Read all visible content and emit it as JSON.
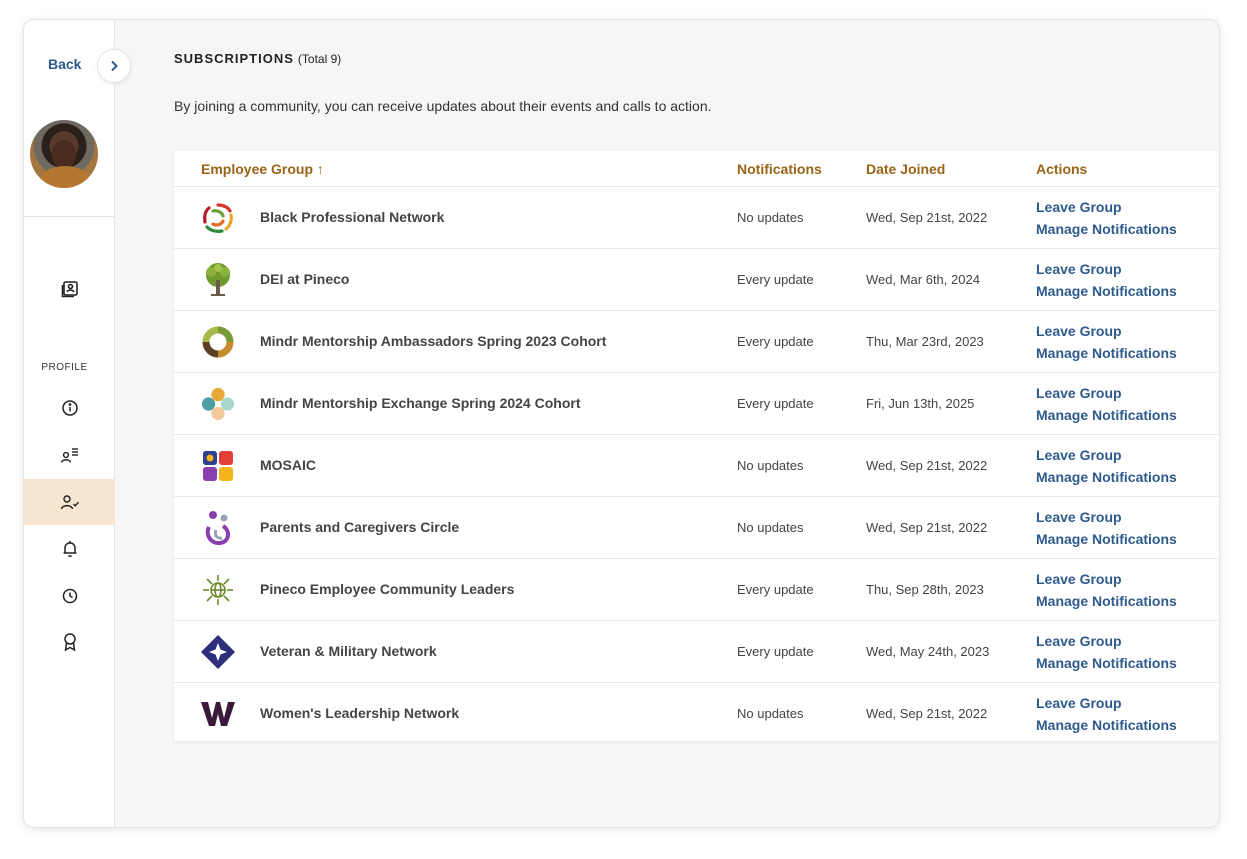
{
  "nav": {
    "back_label": "Back",
    "profile_section_label": "PROFILE",
    "icons": [
      "expand-chevron-icon",
      "newspaper-icon",
      "info-icon",
      "user-list-icon",
      "user-check-icon",
      "bell-icon",
      "clock-icon",
      "award-icon"
    ]
  },
  "page": {
    "title": "SUBSCRIPTIONS",
    "total": "(Total 9)",
    "description": "By joining a community, you can receive updates about their events and calls to action."
  },
  "table": {
    "headers": {
      "group": "Employee Group ↑",
      "notifications": "Notifications",
      "date_joined": "Date Joined",
      "actions": "Actions"
    },
    "rows": [
      {
        "name": "Black Professional Network",
        "notifications": "No updates",
        "date": "Wed, Sep 21st, 2022",
        "leave": "Leave Group",
        "manage": "Manage Notifications",
        "logo": "multicolor-ring-logo"
      },
      {
        "name": "DEI at Pineco",
        "notifications": "Every update",
        "date": "Wed, Mar 6th, 2024",
        "leave": "Leave Group",
        "manage": "Manage Notifications",
        "logo": "tree-logo"
      },
      {
        "name": "Mindr Mentorship Ambassadors Spring 2023 Cohort",
        "notifications": "Every update",
        "date": "Thu, Mar 23rd, 2023",
        "leave": "Leave Group",
        "manage": "Manage Notifications",
        "logo": "segmented-circle-logo"
      },
      {
        "name": "Mindr Mentorship Exchange Spring 2024 Cohort",
        "notifications": "Every update",
        "date": "Fri, Jun 13th, 2025",
        "leave": "Leave Group",
        "manage": "Manage Notifications",
        "logo": "dots-cluster-logo"
      },
      {
        "name": "MOSAIC",
        "notifications": "No updates",
        "date": "Wed, Sep 21st, 2022",
        "leave": "Leave Group",
        "manage": "Manage Notifications",
        "logo": "mosaic-tiles-logo"
      },
      {
        "name": "Parents and Caregivers Circle",
        "notifications": "No updates",
        "date": "Wed, Sep 21st, 2022",
        "leave": "Leave Group",
        "manage": "Manage Notifications",
        "logo": "parent-child-logo"
      },
      {
        "name": "Pineco Employee Community Leaders",
        "notifications": "Every update",
        "date": "Thu, Sep 28th, 2023",
        "leave": "Leave Group",
        "manage": "Manage Notifications",
        "logo": "globe-burst-logo"
      },
      {
        "name": "Veteran & Military Network",
        "notifications": "Every update",
        "date": "Wed, May 24th, 2023",
        "leave": "Leave Group",
        "manage": "Manage Notifications",
        "logo": "diamond-star-logo"
      },
      {
        "name": "Women's Leadership Network",
        "notifications": "No updates",
        "date": "Wed, Sep 21st, 2022",
        "leave": "Leave Group",
        "manage": "Manage Notifications",
        "logo": "w-letter-logo"
      }
    ]
  },
  "colors": {
    "accent_header": "#9a6416",
    "link": "#2f5a8c",
    "active_nav_bg": "#f7e6d0"
  }
}
